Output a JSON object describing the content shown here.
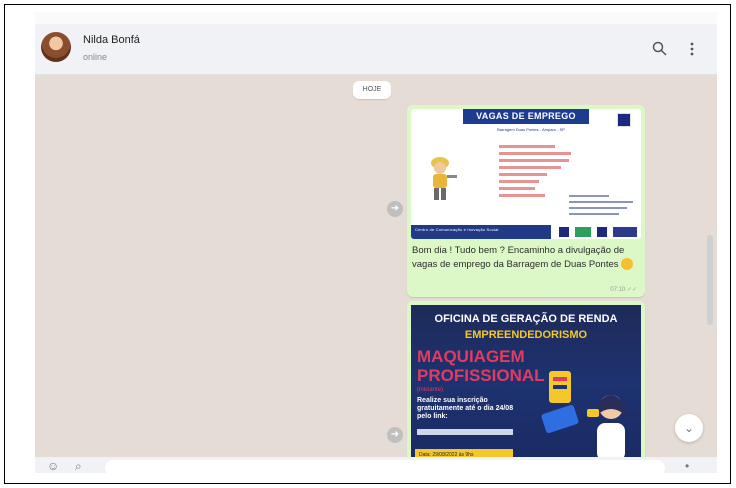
{
  "contact": {
    "name": "Nilda Bonfá",
    "status": "online"
  },
  "chat": {
    "date_label": "HOJE",
    "messages": [
      {
        "image": {
          "title": "VAGAS DE EMPREGO",
          "subtitle": "Barragem Duas Pontes - Amparo - SP",
          "footer": "Centro de Comunicação e Inovação Social"
        },
        "text": "Bom dia ! Tudo bem ? Encaminho a divulgação de vagas de emprego da Barragem de Duas Pontes",
        "time": "07:10"
      },
      {
        "image": {
          "title": "OFICINA DE GERAÇÃO DE RENDA",
          "subtitle": "EMPREENDEDORISMO",
          "headline_line1": "MAQUIAGEM",
          "headline_line2": "PROFISSIONAL",
          "tag": "(iniciante)",
          "cta": "Realize sua inscrição gratuitamente até o dia 24/08 pelo link:",
          "date": "Data: 29/08/2022 às 9hs"
        }
      }
    ]
  },
  "icons": {
    "search": "search-icon",
    "menu": "more-vertical-icon",
    "forward": "forward-icon",
    "scroll": "chevron-down-icon"
  },
  "colors": {
    "bubble": "#dcf8c6",
    "chat_bg": "#e5ddd5",
    "header_bg": "#f0f2f5"
  }
}
